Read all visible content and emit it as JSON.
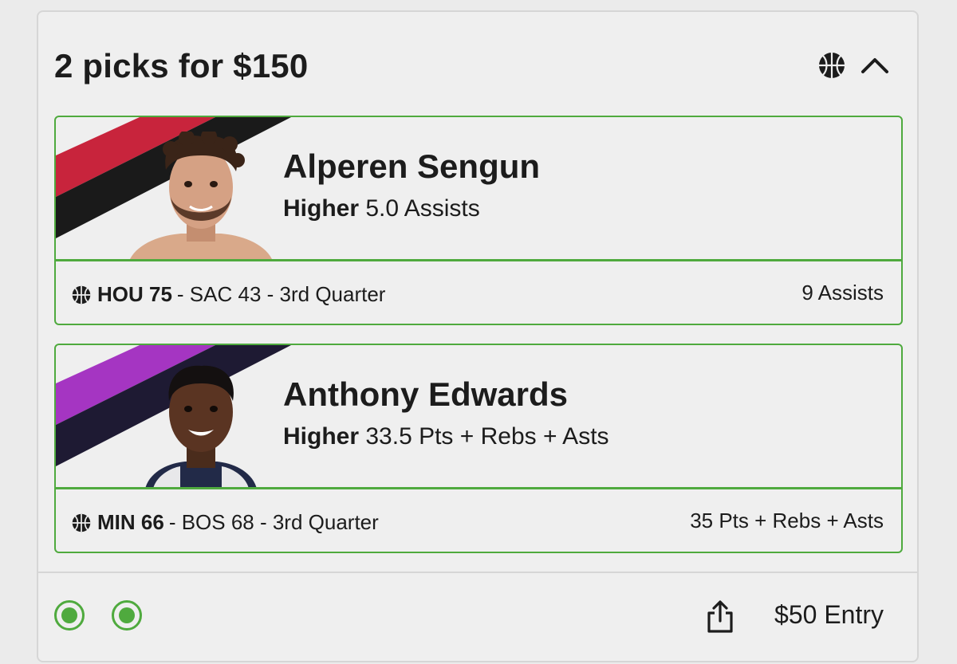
{
  "header": {
    "title": "2 picks for $150",
    "sport_icon": "basketball-icon",
    "toggle_icon": "chevron-up-icon"
  },
  "picks": [
    {
      "player": "Alperen Sengun",
      "direction": "Higher",
      "line": "5.0 Assists",
      "game": {
        "team": "HOU 75",
        "rest": "- SAC 43 - 3rd Quarter"
      },
      "result": "9 Assists",
      "stripe_colors": [
        "#c8243c",
        "#1a1a1a"
      ]
    },
    {
      "player": "Anthony Edwards",
      "direction": "Higher",
      "line": "33.5 Pts + Rebs + Asts",
      "game": {
        "team": "MIN 66",
        "rest": "- BOS 68 - 3rd Quarter"
      },
      "result": "35 Pts + Rebs + Asts",
      "stripe_colors": [
        "#a535c2",
        "#1e1a33"
      ]
    }
  ],
  "footer": {
    "share_icon": "share-icon",
    "entry": "$50 Entry"
  },
  "colors": {
    "accent_green": "#4faa3e",
    "background": "#efefef",
    "border": "#d6d6d6"
  }
}
